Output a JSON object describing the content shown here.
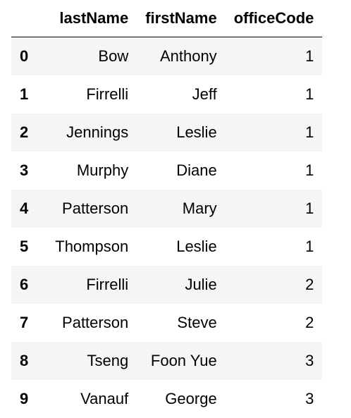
{
  "table": {
    "index_header": "",
    "columns": [
      "lastName",
      "firstName",
      "officeCode"
    ],
    "rows": [
      {
        "index": "0",
        "lastName": "Bow",
        "firstName": "Anthony",
        "officeCode": "1"
      },
      {
        "index": "1",
        "lastName": "Firrelli",
        "firstName": "Jeff",
        "officeCode": "1"
      },
      {
        "index": "2",
        "lastName": "Jennings",
        "firstName": "Leslie",
        "officeCode": "1"
      },
      {
        "index": "3",
        "lastName": "Murphy",
        "firstName": "Diane",
        "officeCode": "1"
      },
      {
        "index": "4",
        "lastName": "Patterson",
        "firstName": "Mary",
        "officeCode": "1"
      },
      {
        "index": "5",
        "lastName": "Thompson",
        "firstName": "Leslie",
        "officeCode": "1"
      },
      {
        "index": "6",
        "lastName": "Firrelli",
        "firstName": "Julie",
        "officeCode": "2"
      },
      {
        "index": "7",
        "lastName": "Patterson",
        "firstName": "Steve",
        "officeCode": "2"
      },
      {
        "index": "8",
        "lastName": "Tseng",
        "firstName": "Foon Yue",
        "officeCode": "3"
      },
      {
        "index": "9",
        "lastName": "Vanauf",
        "firstName": "George",
        "officeCode": "3"
      }
    ]
  },
  "colors": {
    "text": "#000000",
    "row_stripe": "#f5f5f5",
    "background": "#ffffff",
    "header_rule": "#000000"
  }
}
